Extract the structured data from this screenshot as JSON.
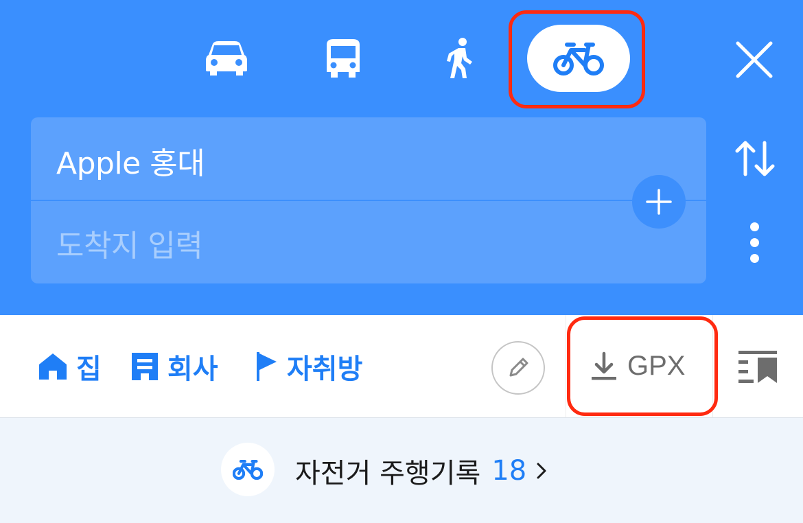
{
  "transport_modes": [
    {
      "name": "car",
      "icon": "car-icon",
      "selected": false
    },
    {
      "name": "bus",
      "icon": "bus-icon",
      "selected": false
    },
    {
      "name": "walk",
      "icon": "walk-icon",
      "selected": false
    },
    {
      "name": "bike",
      "icon": "bike-icon",
      "selected": true
    }
  ],
  "route": {
    "origin": "Apple 홍대",
    "destination_placeholder": "도착지 입력"
  },
  "shortcuts": [
    {
      "label": "집",
      "icon": "home-icon"
    },
    {
      "label": "회사",
      "icon": "building-icon"
    },
    {
      "label": "자취방",
      "icon": "flag-icon"
    }
  ],
  "gpx_label": "GPX",
  "ride_record": {
    "label": "자전거 주행기록",
    "count": "18"
  },
  "colors": {
    "header_blue": "#3a8ffe",
    "card_blue": "#5ca1fd",
    "accent": "#1f7ef6",
    "highlight": "#ff2a10",
    "strip_bg": "#eff5fc"
  }
}
